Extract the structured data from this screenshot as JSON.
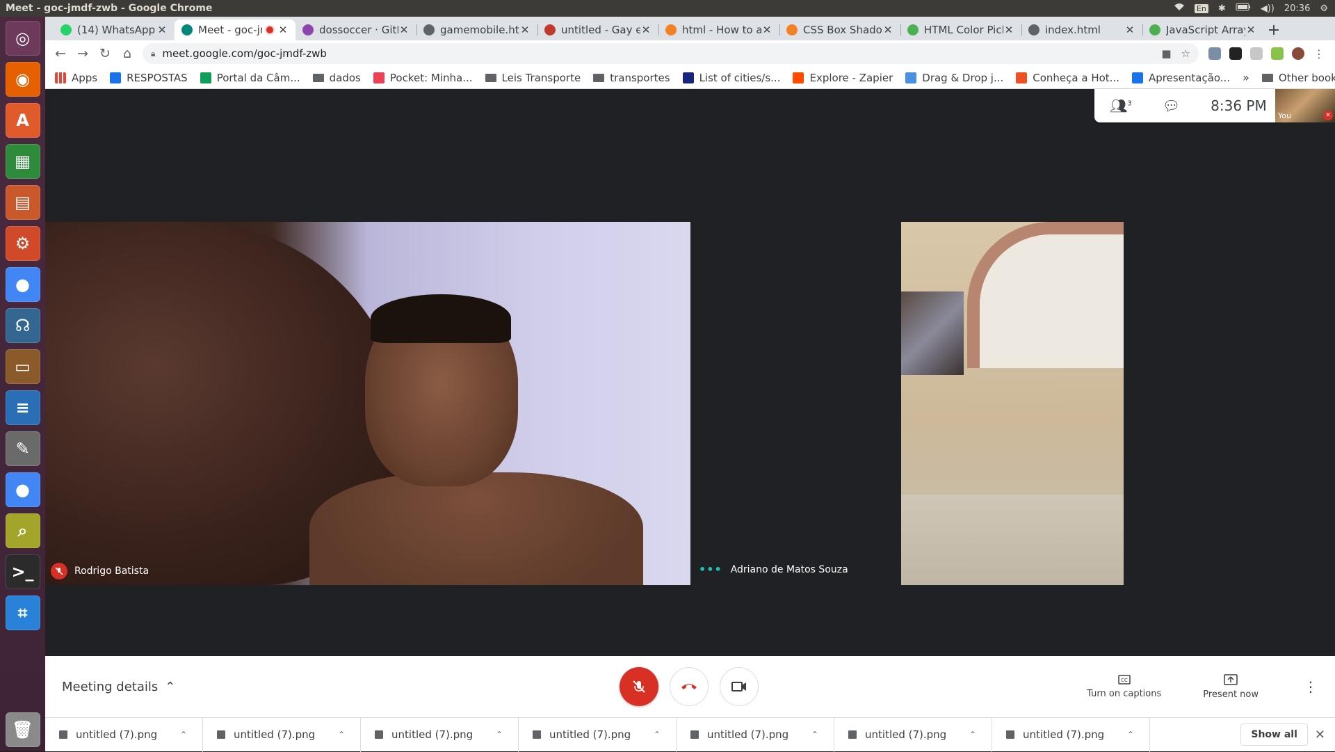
{
  "os": {
    "window_title": "Meet - goc-jmdf-zwb - Google Chrome",
    "lang": "En",
    "clock": "20:36"
  },
  "tabs": [
    {
      "label": "(14) WhatsApp",
      "color": "#25d366",
      "icon": "whatsapp-icon"
    },
    {
      "label": "Meet - goc-jmdf-zwb",
      "color": "#00897b",
      "icon": "meet-icon",
      "active": true
    },
    {
      "label": "dossoccer · GitHub",
      "color": "#8e44ad",
      "icon": "github-icon"
    },
    {
      "label": "gamemobile.html",
      "color": "#5f6368",
      "icon": "globe-icon"
    },
    {
      "label": "untitled - Gay es",
      "color": "#c0392b",
      "icon": "image-icon"
    },
    {
      "label": "html - How to all",
      "color": "#f48024",
      "icon": "stackoverflow-icon"
    },
    {
      "label": "CSS Box Shadow",
      "color": "#f48024",
      "icon": "stackoverflow-icon"
    },
    {
      "label": "HTML Color Pick",
      "color": "#4caf50",
      "icon": "w3schools-icon"
    },
    {
      "label": "index.html",
      "color": "#5f6368",
      "icon": "globe-icon"
    },
    {
      "label": "JavaScript Array",
      "color": "#4caf50",
      "icon": "w3schools-icon"
    }
  ],
  "address": {
    "url": "meet.google.com/goc-jmdf-zwb"
  },
  "bookmarks": [
    {
      "label": "Apps",
      "type": "apps",
      "color": "#5f6368"
    },
    {
      "label": "RESPOSTAS",
      "type": "site",
      "color": "#1a73e8"
    },
    {
      "label": "Portal da Câm...",
      "type": "site",
      "color": "#0f9d58"
    },
    {
      "label": "dados",
      "type": "folder"
    },
    {
      "label": "Pocket: Minha...",
      "type": "site",
      "color": "#ef4056"
    },
    {
      "label": "Leis Transporte",
      "type": "folder"
    },
    {
      "label": "transportes",
      "type": "folder"
    },
    {
      "label": "List of cities/s...",
      "type": "site",
      "color": "#1a237e"
    },
    {
      "label": "Explore - Zapier",
      "type": "site",
      "color": "#ff4a00"
    },
    {
      "label": "Drag & Drop j...",
      "type": "site",
      "color": "#4a90e2"
    },
    {
      "label": "Conheça a Hot...",
      "type": "site",
      "color": "#f04e23"
    },
    {
      "label": "Apresentação...",
      "type": "site",
      "color": "#1a73e8"
    }
  ],
  "bookmarks_more": "»",
  "other_bookmarks": "Other bookmarks",
  "meet": {
    "participant_count": "3",
    "time": "8:36 PM",
    "self_label": "You",
    "participants": [
      {
        "name": "Rodrigo Batista",
        "muted": true
      },
      {
        "name": "Adriano de Matos Souza",
        "speaking": true
      }
    ]
  },
  "controls": {
    "meeting_details": "Meeting details",
    "captions": "Turn on captions",
    "present": "Present now"
  },
  "downloads": {
    "items": [
      "untitled (7).png",
      "untitled (7).png",
      "untitled (7).png",
      "untitled (7).png",
      "untitled (7).png",
      "untitled (7).png",
      "untitled (7).png"
    ],
    "show_all": "Show all"
  },
  "launcher": [
    {
      "icon": "ubuntu-dash-icon",
      "color": "#6e3a5c"
    },
    {
      "icon": "firefox-icon",
      "color": "#e66000"
    },
    {
      "icon": "software-center-icon",
      "color": "#e05a2b"
    },
    {
      "icon": "spreadsheet-icon",
      "color": "#2e8b3c"
    },
    {
      "icon": "presentation-icon",
      "color": "#c9582b"
    },
    {
      "icon": "settings-icon",
      "color": "#d04a2a"
    },
    {
      "icon": "chrome-icon",
      "color": "#4285f4"
    },
    {
      "icon": "pgadmin-icon",
      "color": "#336791"
    },
    {
      "icon": "files-icon",
      "color": "#8b5a2b"
    },
    {
      "icon": "writer-icon",
      "color": "#2a6fb5"
    },
    {
      "icon": "text-editor-icon",
      "color": "#6a6a6a"
    },
    {
      "icon": "chrome-icon",
      "color": "#4285f4"
    },
    {
      "icon": "image-viewer-icon",
      "color": "#a3a52a"
    },
    {
      "icon": "terminal-icon",
      "color": "#2b2b2b"
    },
    {
      "icon": "code-editor-icon",
      "color": "#2a82d8"
    }
  ]
}
